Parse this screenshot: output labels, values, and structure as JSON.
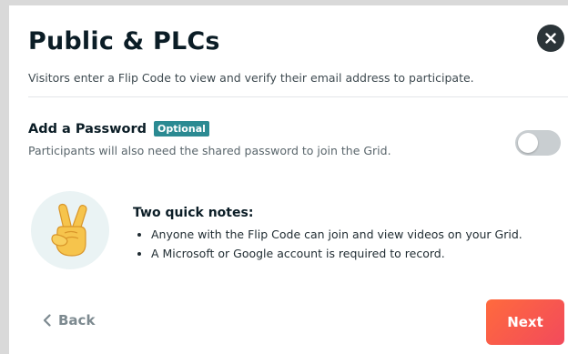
{
  "modal": {
    "title": "Public & PLCs",
    "subtitle": "Visitors enter a Flip Code to view and verify their email address to participate.",
    "close_icon": "close-icon"
  },
  "password": {
    "title": "Add a Password",
    "badge": "Optional",
    "description": "Participants will also need the shared password to join the Grid.",
    "toggle_on": false
  },
  "notes": {
    "icon": "peace-hand-icon",
    "title": "Two quick notes:",
    "items": [
      "Anyone with the Flip Code can join and view videos on your Grid.",
      "A Microsoft or Google account is required to record."
    ]
  },
  "footer": {
    "back_label": "Back",
    "next_label": "Next"
  },
  "colors": {
    "badge": "#2b8a92",
    "next_gradient_start": "#ff6a3d",
    "next_gradient_end": "#f24a5c",
    "toggle_off": "#c9ced1"
  }
}
